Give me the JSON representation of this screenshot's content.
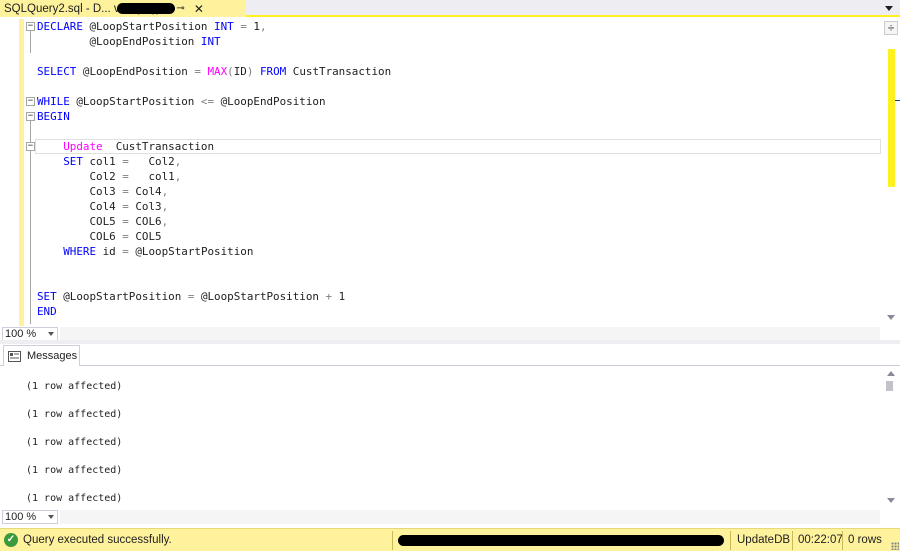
{
  "tab": {
    "title": "SQLQuery2.sql - D...                ved (51))*",
    "pin_glyph": "⊸",
    "close_glyph": "✕"
  },
  "editor": {
    "split_glyph": "÷",
    "lines": [
      [
        {
          "t": "DECLARE ",
          "c": "kw"
        },
        {
          "t": "@LoopStartPosition ",
          "c": "var"
        },
        {
          "t": "INT",
          "c": "kw"
        },
        {
          "t": " = ",
          "c": "op"
        },
        {
          "t": "1",
          "c": "var"
        },
        {
          "t": ",",
          "c": "op"
        }
      ],
      [
        {
          "t": "        @LoopEndPosition ",
          "c": "var"
        },
        {
          "t": "INT",
          "c": "kw"
        }
      ],
      [],
      [
        {
          "t": "SELECT ",
          "c": "kw"
        },
        {
          "t": "@LoopEndPosition ",
          "c": "var"
        },
        {
          "t": "= ",
          "c": "op"
        },
        {
          "t": "MAX",
          "c": "fn"
        },
        {
          "t": "(",
          "c": "op"
        },
        {
          "t": "ID",
          "c": "var"
        },
        {
          "t": ") ",
          "c": "op"
        },
        {
          "t": "FROM ",
          "c": "kw"
        },
        {
          "t": "CustTransaction",
          "c": "var"
        }
      ],
      [],
      [
        {
          "t": "WHILE ",
          "c": "kw"
        },
        {
          "t": "@LoopStartPosition ",
          "c": "var"
        },
        {
          "t": "<=",
          "c": "op"
        },
        {
          "t": " @LoopEndPosition",
          "c": "var"
        }
      ],
      [
        {
          "t": "BEGIN",
          "c": "kw"
        }
      ],
      [],
      [
        {
          "t": "    ",
          "c": "var"
        },
        {
          "t": "Update",
          "c": "fn"
        },
        {
          "t": "  CustTransaction",
          "c": "var"
        }
      ],
      [
        {
          "t": "    ",
          "c": "var"
        },
        {
          "t": "SET ",
          "c": "kw"
        },
        {
          "t": "col1 ",
          "c": "var"
        },
        {
          "t": "= ",
          "c": "op"
        },
        {
          "t": "  Col2",
          "c": "var"
        },
        {
          "t": ",",
          "c": "op"
        }
      ],
      [
        {
          "t": "        Col2 ",
          "c": "var"
        },
        {
          "t": "= ",
          "c": "op"
        },
        {
          "t": "  col1",
          "c": "var"
        },
        {
          "t": ",",
          "c": "op"
        }
      ],
      [
        {
          "t": "        Col3 ",
          "c": "var"
        },
        {
          "t": "= ",
          "c": "op"
        },
        {
          "t": "Col4",
          "c": "var"
        },
        {
          "t": ",",
          "c": "op"
        }
      ],
      [
        {
          "t": "        Col4 ",
          "c": "var"
        },
        {
          "t": "= ",
          "c": "op"
        },
        {
          "t": "Col3",
          "c": "var"
        },
        {
          "t": ",",
          "c": "op"
        }
      ],
      [
        {
          "t": "        COL5 ",
          "c": "var"
        },
        {
          "t": "= ",
          "c": "op"
        },
        {
          "t": "COL6",
          "c": "var"
        },
        {
          "t": ",",
          "c": "op"
        }
      ],
      [
        {
          "t": "        COL6 ",
          "c": "var"
        },
        {
          "t": "= ",
          "c": "op"
        },
        {
          "t": "COL5",
          "c": "var"
        }
      ],
      [
        {
          "t": "    ",
          "c": "var"
        },
        {
          "t": "WHERE ",
          "c": "kw"
        },
        {
          "t": "id ",
          "c": "var"
        },
        {
          "t": "= ",
          "c": "op"
        },
        {
          "t": "@LoopStartPosition",
          "c": "var"
        }
      ],
      [],
      [],
      [
        {
          "t": "SET ",
          "c": "kw"
        },
        {
          "t": "@LoopStartPosition ",
          "c": "var"
        },
        {
          "t": "= ",
          "c": "op"
        },
        {
          "t": "@LoopStartPosition ",
          "c": "var"
        },
        {
          "t": "+ ",
          "c": "op"
        },
        {
          "t": "1",
          "c": "var"
        }
      ],
      [
        {
          "t": "END",
          "c": "kw"
        }
      ]
    ]
  },
  "editor_zoom": "100 %",
  "messages": {
    "tab_label": "Messages",
    "lines": [
      "(1 row affected)",
      "(1 row affected)",
      "(1 row affected)",
      "(1 row affected)",
      "(1 row affected)"
    ]
  },
  "messages_zoom": "100 %",
  "status": {
    "message": "Query executed successfully.",
    "database": "UpdateDB",
    "elapsed": "00:22:07",
    "rows": "0 rows"
  },
  "colors": {
    "keyword": "#0000ff",
    "function": "#ff00ff",
    "operator": "#808080",
    "accent_yellow": "#fff29d",
    "status_ok": "#3c9a3c"
  }
}
